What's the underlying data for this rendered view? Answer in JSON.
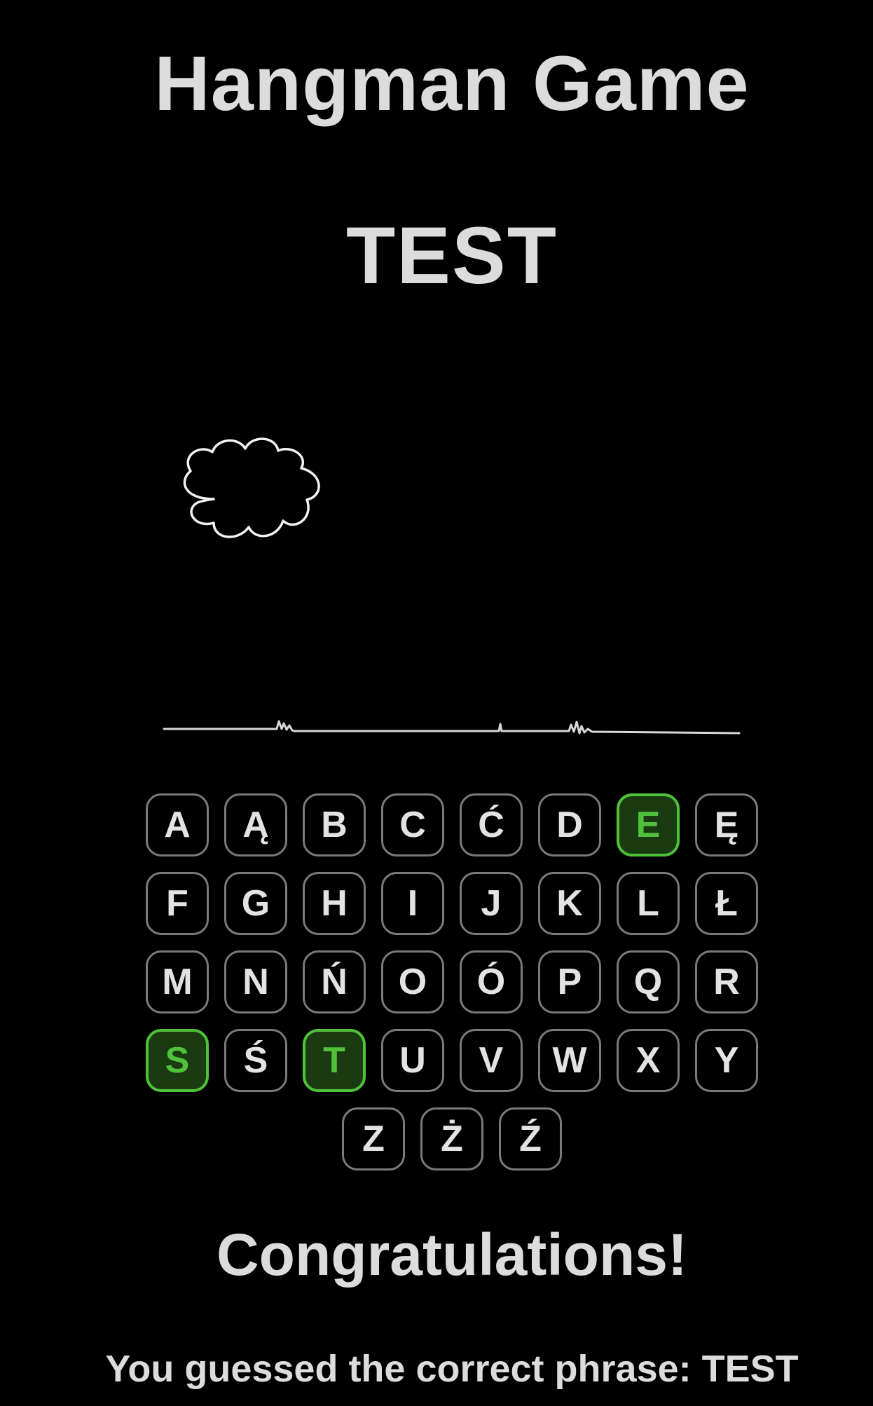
{
  "title": "Hangman Game",
  "phrase": "TEST",
  "keyboard": {
    "rows": [
      [
        "A",
        "Ą",
        "B",
        "C",
        "Ć",
        "D",
        "E",
        "Ę"
      ],
      [
        "F",
        "G",
        "H",
        "I",
        "J",
        "K",
        "L",
        "Ł"
      ],
      [
        "M",
        "N",
        "Ń",
        "O",
        "Ó",
        "P",
        "Q",
        "R"
      ],
      [
        "S",
        "Ś",
        "T",
        "U",
        "V",
        "W",
        "X",
        "Y"
      ],
      [
        "Z",
        "Ż",
        "Ź"
      ]
    ],
    "correct_letters": [
      "E",
      "S",
      "T"
    ]
  },
  "colors": {
    "background": "#000000",
    "text": "#dcdcdc",
    "key_border": "#7a7a7a",
    "correct": "#4fc13a",
    "correct_bg": "#1a3a12"
  },
  "icons": [
    "cloud-icon",
    "ground-line"
  ],
  "message": {
    "heading": "Congratulations!",
    "body": "You guessed the correct phrase: TEST"
  }
}
